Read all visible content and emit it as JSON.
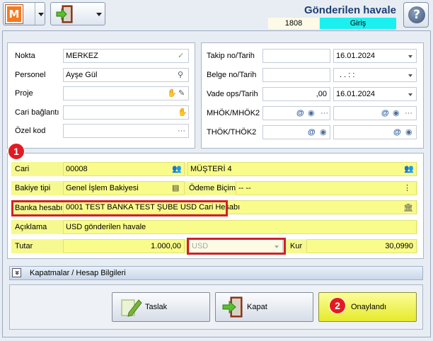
{
  "header": {
    "title": "Gönderilen havale",
    "doc_number": "1808",
    "doc_status": "Giriş",
    "logo_letter": "M",
    "help_label": "?"
  },
  "top_left": {
    "nokta_label": "Nokta",
    "nokta_value": "MERKEZ",
    "personel_label": "Personel",
    "personel_value": "Ayşe Gül",
    "proje_label": "Proje",
    "proje_value": "",
    "cari_baglanti_label": "Cari bağlantı",
    "cari_baglanti_value": "",
    "ozel_kod_label": "Özel kod",
    "ozel_kod_value": ""
  },
  "top_right": {
    "takip_label": "Takip no/Tarih",
    "takip_no": "",
    "takip_tarih": "16.01.2024",
    "belge_label": "Belge no/Tarih",
    "belge_no": "",
    "belge_tarih": ".   .      :   :",
    "vade_label": "Vade ops/Tarih",
    "vade_ops": ",00",
    "vade_tarih": "16.01.2024",
    "mhok_label": "MHÖK/MHÖK2",
    "thok_label": "THÖK/THÖK2",
    "at_symbol": "@",
    "ellipsis": "···"
  },
  "main": {
    "cari_label": "Cari",
    "cari_code": "00008",
    "cari_name": "MÜŞTERİ 4",
    "bakiye_label": "Bakiye tipi",
    "bakiye_value": "Genel İşlem Bakiyesi",
    "odeme_label": "Ödeme Biçimi",
    "odeme_value": "-- --",
    "banka_label": "Banka hesabı",
    "banka_value": "0001 TEST BANKA TEST ŞUBE USD Cari Hesabı",
    "aciklama_label": "Açıklama",
    "aciklama_value": "USD gönderilen havale",
    "tutar_label": "Tutar",
    "tutar_value": "1.000,00",
    "currency_value": "USD",
    "kur_label": "Kur",
    "kur_value": "30,0990"
  },
  "kapatmalar": {
    "label": "Kapatmalar / Hesap Bilgileri",
    "expand_glyph": "»"
  },
  "footer": {
    "taslak_label": "Taslak",
    "kapat_label": "Kapat",
    "onay_label": "Onaylandı"
  },
  "badges": {
    "badge1": "1",
    "badge2": "2"
  },
  "colors": {
    "title": "#1d3f73",
    "status_bg": "#1cf0ef",
    "highlight_yellow": "#f6f98f",
    "onay_button": "#f2f53c",
    "annotation_red": "#d0212a"
  }
}
